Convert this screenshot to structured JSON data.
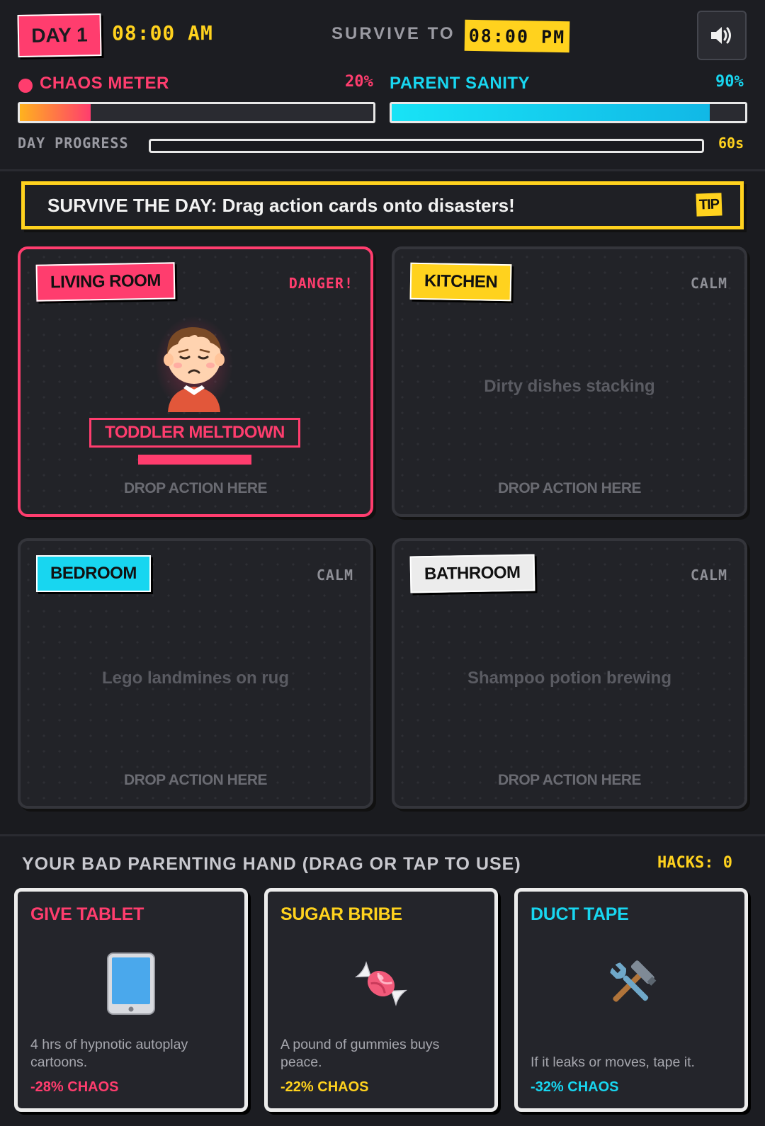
{
  "header": {
    "day": "DAY 1",
    "clock": "08:00 AM",
    "survive_label": "SURVIVE TO",
    "survive_time": "08:00 PM",
    "sound_icon": "speaker-icon"
  },
  "meters": {
    "chaos_label": "CHAOS METER",
    "chaos_pct": "20%",
    "chaos_value": 0.2,
    "sanity_label": "PARENT SANITY",
    "sanity_pct": "90%",
    "sanity_value": 0.9,
    "progress_label": "DAY PROGRESS",
    "progress_time": "60s",
    "progress_value": 0.0
  },
  "tip": {
    "text": "SURVIVE THE DAY: Drag action cards onto disasters!",
    "badge": "TIP"
  },
  "rooms": [
    {
      "name": "LIVING ROOM",
      "status": "DANGER!",
      "state": "danger",
      "tag_color": "#ff3d6e",
      "disaster": "TODDLER MELTDOWN",
      "timer_value": 1.0,
      "drop": "DROP ACTION HERE",
      "icon": "crying-toddler-icon"
    },
    {
      "name": "KITCHEN",
      "status": "CALM",
      "state": "calm",
      "tag_color": "#ffd21e",
      "desc": "Dirty dishes stacking",
      "drop": "DROP ACTION HERE"
    },
    {
      "name": "BEDROOM",
      "status": "CALM",
      "state": "calm",
      "tag_color": "#18d6f0",
      "desc": "Lego landmines on rug",
      "drop": "DROP ACTION HERE"
    },
    {
      "name": "BATHROOM",
      "status": "CALM",
      "state": "calm",
      "tag_color": "#ececec",
      "desc": "Shampoo potion brewing",
      "drop": "DROP ACTION HERE"
    }
  ],
  "hand": {
    "title": "YOUR BAD PARENTING HAND (DRAG OR TAP TO USE)",
    "hacks": "HACKS: 0",
    "cards": [
      {
        "title": "GIVE TABLET",
        "color": "#ff3d6e",
        "icon": "tablet-icon",
        "desc": "4 hrs of hypnotic autoplay cartoons.",
        "effect": "-28% CHAOS"
      },
      {
        "title": "SUGAR BRIBE",
        "color": "#ffd21e",
        "icon": "candy-icon",
        "desc": "A pound of gummies buys peace.",
        "effect": "-22% CHAOS"
      },
      {
        "title": "DUCT TAPE",
        "color": "#18d6f0",
        "icon": "hammer-wrench-icon",
        "desc": "If it leaks or moves, tape it.",
        "effect": "-32% CHAOS"
      }
    ]
  }
}
